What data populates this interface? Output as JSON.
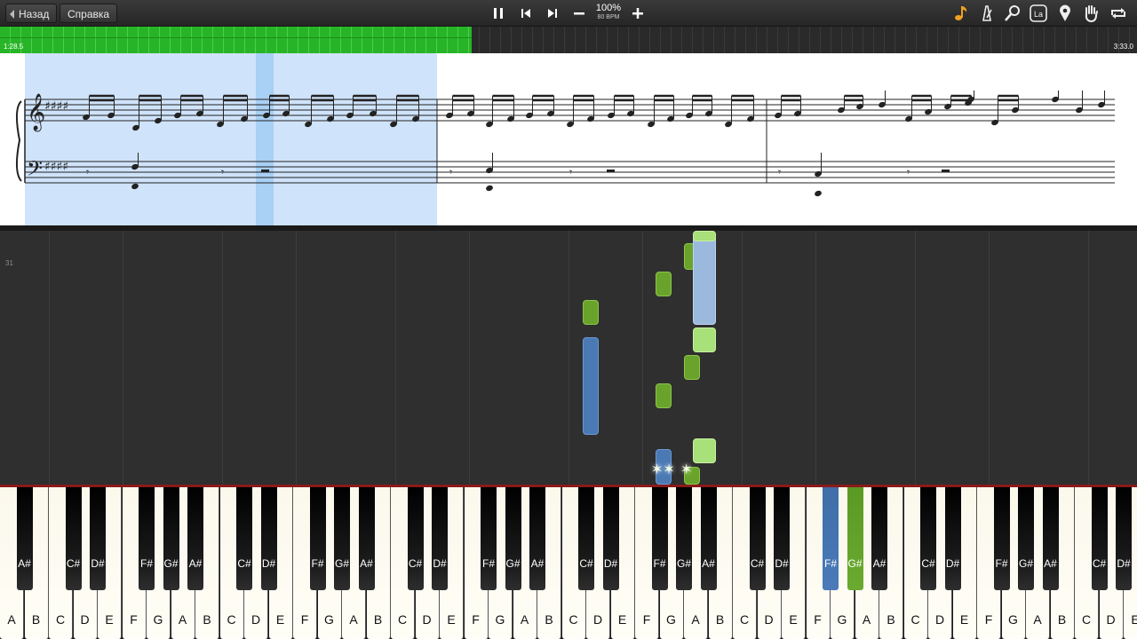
{
  "toolbar": {
    "back_label": "Назад",
    "help_label": "Справка",
    "tempo_percent": "100%",
    "tempo_bpm": "80 BPM"
  },
  "progress": {
    "time_elapsed": "1:28.5",
    "time_total": "3:33.0",
    "fraction": 0.415
  },
  "notes_area": {
    "measure_number": "31"
  },
  "keyboard": {
    "white_keys": [
      "A",
      "B",
      "C",
      "D",
      "E",
      "F",
      "G",
      "A",
      "B",
      "C",
      "D",
      "E",
      "F",
      "G",
      "A",
      "B",
      "C",
      "D",
      "E",
      "F",
      "G",
      "A",
      "B",
      "C",
      "D",
      "E",
      "F",
      "G",
      "A",
      "B",
      "C",
      "D",
      "E",
      "F",
      "G",
      "A",
      "B",
      "C",
      "D",
      "E",
      "F",
      "G",
      "A",
      "B",
      "C",
      "D",
      "E"
    ],
    "black_keys": [
      "A#",
      "C#",
      "D#",
      "F#",
      "G#",
      "A#",
      "C#",
      "D#",
      "F#",
      "G#",
      "A#",
      "C#",
      "D#",
      "F#",
      "G#",
      "A#",
      "C#",
      "D#",
      "F#",
      "G#",
      "A#",
      "C#",
      "D#",
      "F#",
      "G#",
      "A#",
      "C#",
      "D#",
      "F#",
      "G#",
      "A#",
      "C#",
      "D#"
    ]
  },
  "colors": {
    "left_hand": "#4a79b4",
    "right_hand": "#6aa32b",
    "progress": "#27b527",
    "score_highlight": "#cfe3fa"
  }
}
